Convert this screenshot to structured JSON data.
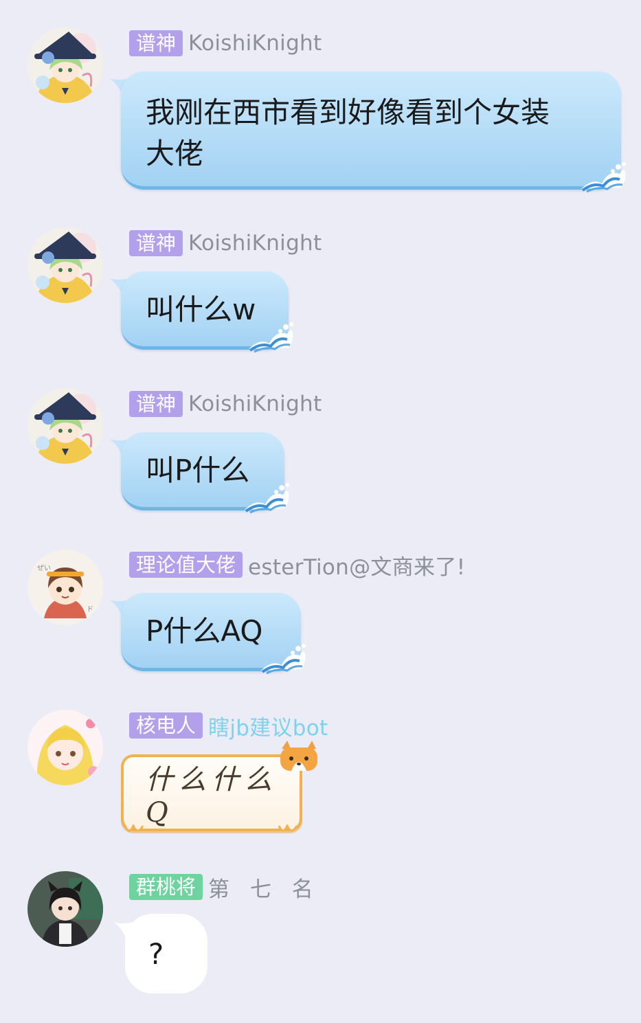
{
  "messages": [
    {
      "avatar_icon": "witch-hat-girl-avatar-icon",
      "tag": "谱神",
      "nickname": "KoishiKnight",
      "text_lines": [
        "我刚在西市看到好像看到个女装",
        "大佬"
      ],
      "bubble_style": "blue-wave"
    },
    {
      "avatar_icon": "witch-hat-girl-avatar-icon",
      "tag": "谱神",
      "nickname": "KoishiKnight",
      "text": "叫什么w",
      "bubble_style": "blue-wave"
    },
    {
      "avatar_icon": "witch-hat-girl-avatar-icon",
      "tag": "谱神",
      "nickname": "KoishiKnight",
      "text": "叫P什么",
      "bubble_style": "blue-wave"
    },
    {
      "avatar_icon": "anime-girl-avatar-icon",
      "tag": "理论值大佬",
      "nickname": "esterTion@文商来了!",
      "text": "P什么AQ",
      "bubble_style": "blue-wave"
    },
    {
      "avatar_icon": "blonde-girl-avatar-icon",
      "tag": "核电人",
      "nickname": "瞎jb建议bot",
      "text": "什么什么Q",
      "bubble_style": "corgi-scroll"
    },
    {
      "avatar_icon": "dark-hair-girl-avatar-icon",
      "tag": "群桃将",
      "nickname": "第 七 名",
      "text": "?",
      "bubble_style": "plain-white"
    }
  ],
  "colors": {
    "background": "#ececf6",
    "tag_purple": "#b3a0ea",
    "tag_green": "#6fd3a0",
    "nickname_gray": "#8d8f99",
    "nickname_cyan": "#7fd2ec",
    "bubble_blue": "#b5dcf7"
  }
}
